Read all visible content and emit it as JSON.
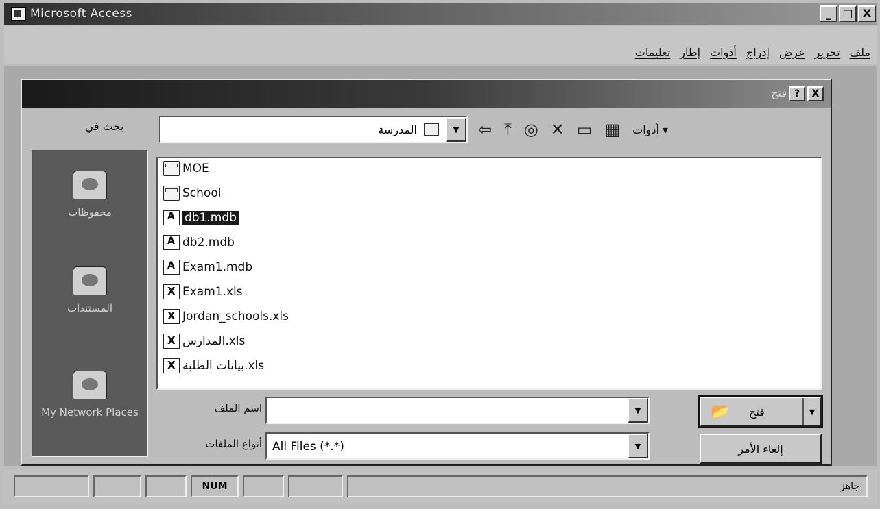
{
  "window": {
    "title": "Microsoft Access",
    "buttons": [
      "_",
      "□",
      "X"
    ]
  },
  "menu": [
    "ملف",
    "تحرير",
    "عرض",
    "إدراج",
    "أدوات",
    "إطار",
    "تعليمات"
  ],
  "dialog": {
    "title": "فتح",
    "help_button": "?",
    "close_button": "X",
    "look_in_label": "بحث في",
    "look_in_value": "المدرسة",
    "tools_label": "أدوات",
    "places": [
      {
        "label": "محفوظات",
        "icon": "history-icon"
      },
      {
        "label": "المستندات",
        "icon": "my-documents-icon"
      },
      {
        "label": "My Network Places",
        "icon": "network-places-icon"
      }
    ],
    "files": [
      {
        "name": "MOE",
        "icon": "folder-icon",
        "selected": false
      },
      {
        "name": "School",
        "icon": "folder-icon",
        "selected": false
      },
      {
        "name": "db1.mdb",
        "icon": "access-file-icon",
        "selected": true
      },
      {
        "name": "db2.mdb",
        "icon": "access-file-icon",
        "selected": false
      },
      {
        "name": "Exam1.mdb",
        "icon": "access-file-icon",
        "selected": false
      },
      {
        "name": "Exam1.xls",
        "icon": "excel-file-icon",
        "selected": false
      },
      {
        "name": "Jordan_schools.xls",
        "icon": "excel-file-icon",
        "selected": false
      },
      {
        "name": "المدارس.xls",
        "icon": "excel-file-icon",
        "selected": false
      },
      {
        "name": "بيانات الطلبة.xls",
        "icon": "excel-file-icon",
        "selected": false
      }
    ],
    "file_name_label": "اسم الملف",
    "file_name_value": "",
    "file_type_label": "أنواع الملفات",
    "file_type_value": "All Files (*.*)",
    "open_button": "فتح",
    "cancel_button": "إلغاء الأمر"
  },
  "statusbar": {
    "num": "NUM",
    "ready": "جاهز"
  }
}
